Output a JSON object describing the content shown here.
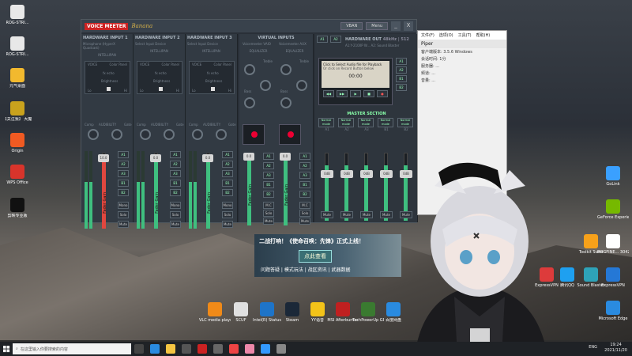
{
  "desktop_left": [
    {
      "label": "ROG-STRI...",
      "color": "#e8e8e8"
    },
    {
      "label": "ROG-STRI...",
      "color": "#e8e8e8"
    },
    {
      "label": "元气桌面",
      "color": "#f2b92e"
    },
    {
      "label": "【关注我】\n大魔",
      "color": "#c9a21d"
    },
    {
      "label": "Origin",
      "color": "#f05a22"
    },
    {
      "label": "WPS Office",
      "color": "#d8342b"
    },
    {
      "label": "剪映专业版",
      "color": "#111111"
    }
  ],
  "desktop_right": [
    {
      "label": "GoLink",
      "color": "#3aa0ff"
    },
    {
      "label": "GeForce\nExperience",
      "color": "#76b900"
    },
    {
      "label": "ROGFINE...\n3042",
      "color": "#ffffff"
    },
    {
      "label": "Toolkit\nSuite",
      "color": "#f7a11a"
    },
    {
      "label": "ExpressVPN",
      "color": "#dd3b3b"
    },
    {
      "label": "腾讯QQ",
      "color": "#1ea0f0"
    },
    {
      "label": "Sound\nBlaster",
      "color": "#2ea3b8"
    },
    {
      "label": "ExpressVPN",
      "color": "#2578d6"
    },
    {
      "label": "Microsoft\nEdge",
      "color": "#2a8be0"
    }
  ],
  "desktop_bottom": [
    {
      "label": "VLC media\nplayer",
      "color": "#f08a18"
    },
    {
      "label": "SCUF",
      "color": "#e0e0e0"
    },
    {
      "label": "Intel(R)\nStatus",
      "color": "#1e74c8"
    },
    {
      "label": "Steam",
      "color": "#1b2838"
    },
    {
      "label": "YY语音",
      "color": "#f3c319"
    },
    {
      "label": "MSI\nAfterburner",
      "color": "#c02020"
    },
    {
      "label": "TechPowerUp\nGPU-Z",
      "color": "#3a7a30"
    },
    {
      "label": "百度网盘",
      "color": "#2a8be0"
    }
  ],
  "voicemeeter": {
    "logo": "VOICE MEETER",
    "brand": "Banana",
    "vban": "VBAN",
    "menu": "Menu",
    "minimize": "_",
    "close": "X",
    "strips": [
      {
        "title": "HARDWARE INPUT 1",
        "sub": "Microphone (HyperX Quadcast)",
        "gain": "10.0",
        "color": "#e0473f"
      },
      {
        "title": "HARDWARE INPUT 2",
        "sub": "Select Input Device",
        "gain": "0.0",
        "color": "#3fbf7f"
      },
      {
        "title": "HARDWARE INPUT 3",
        "sub": "Select Input Device",
        "gain": "0.0",
        "color": "#3fbf7f"
      }
    ],
    "virtual_title": "VIRTUAL INPUTS",
    "virtual": [
      {
        "name": "Voicemeeter VAIO",
        "gain": "0.0"
      },
      {
        "name": "Voicemeeter AUX",
        "gain": "0.0"
      }
    ],
    "intellipan": "INTELLIPAN",
    "voice": "VOICE",
    "color_panel": "Color Panel",
    "fx_echo": "fx echo",
    "brightness": "Brightness",
    "lo": "Lo",
    "hi": "Hi",
    "audibility": "AUDIBILITY",
    "comp": "Comp",
    "gate": "Gate",
    "fader_label": "Fader Gain",
    "equalizer": "EQUALIZER",
    "treble": "Treble",
    "bass": "Bass",
    "mono": "Mono",
    "solo": "Solo",
    "mute": "Mute",
    "mc": "M.C",
    "bus_buttons": [
      "A1",
      "A2",
      "A3",
      "B1",
      "B2"
    ],
    "hw_out_title": "HARDWARE OUT",
    "hw_out_rate": "48kHz | 512",
    "hw_out_sub": "A1:Y-2100P W...  A2: Sound Blaster",
    "out_btn_a1": "A1",
    "out_btn_a2": "A2",
    "recorder_hint": "Click to Select Audio file for Playback",
    "recorder_hint2": "Or click on Record Button below",
    "recorder_time": "00:00",
    "master": "MASTER SECTION",
    "master_buses": [
      "A1",
      "A2",
      "A3",
      "B1",
      "B2"
    ],
    "master_mode": "Normal mode",
    "master_gain": "0dB"
  },
  "properties": {
    "menu": [
      "文件(F)",
      "选项(O)",
      "工具(T)",
      "帮助(H)"
    ],
    "title": "Piper",
    "rows": [
      "客户端版本: 3.5.6 Windows",
      "会话时间: 1分",
      "服务器: ...",
      "频道: ...",
      "音量: ..."
    ]
  },
  "ad": {
    "line1": "二战打响！《使命召唤：先锋》正式上线！",
    "cta": "点此查看",
    "line3": "问题答疑 | 模式玩法 | 战区资讯 | 武器数据"
  },
  "taskbar": {
    "search_placeholder": "在这里输入你要搜索的内容",
    "lang": "ENG",
    "time": "19:24",
    "date": "2021/11/20"
  }
}
